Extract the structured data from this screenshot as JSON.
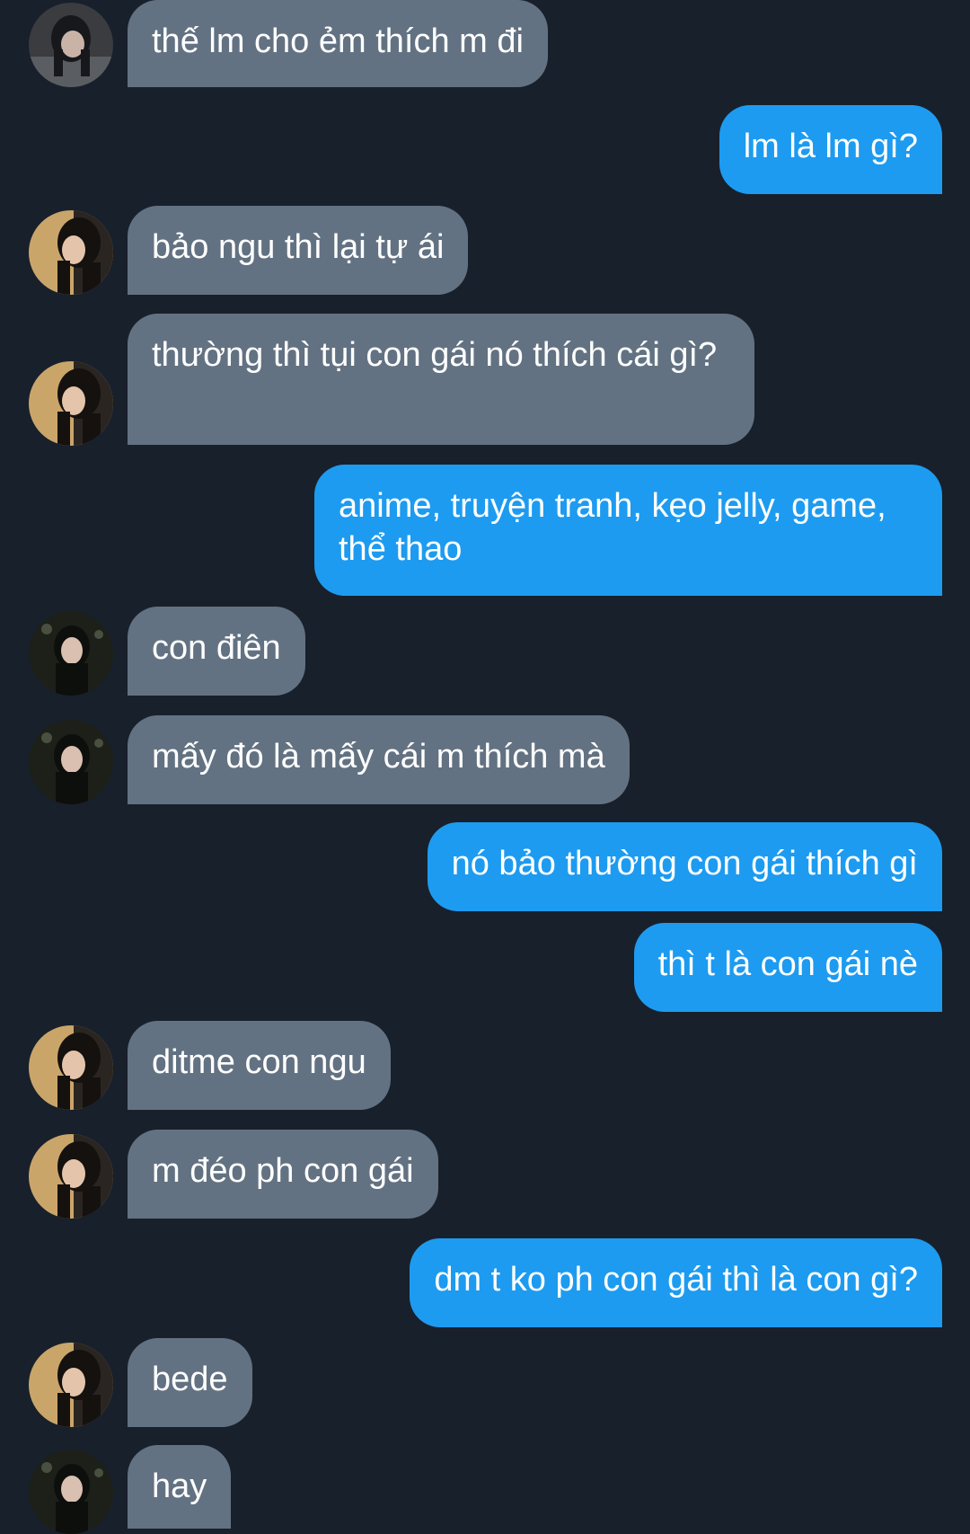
{
  "messages": [
    {
      "side": "in",
      "text": "thế lm cho ẻm thích m đi",
      "avatar": "avatar-photo-1"
    },
    {
      "side": "out",
      "text": "lm là lm gì?"
    },
    {
      "side": "in",
      "text": "bảo ngu thì lại tự ái",
      "avatar": "avatar-photo-2"
    },
    {
      "side": "in",
      "text": "thường thì tụi con gái nó thích cái gì?",
      "avatar": "avatar-photo-2"
    },
    {
      "side": "out",
      "text": "anime, truyện tranh, kẹo jelly, game, thể thao"
    },
    {
      "side": "in",
      "text": "con điên",
      "avatar": "avatar-photo-3"
    },
    {
      "side": "in",
      "text": "mấy đó là mấy cái m thích mà",
      "avatar": "avatar-photo-3"
    },
    {
      "side": "out",
      "text": "nó bảo thường con gái thích gì"
    },
    {
      "side": "out",
      "text": "thì t là con gái nè"
    },
    {
      "side": "in",
      "text": "ditme con ngu",
      "avatar": "avatar-photo-2"
    },
    {
      "side": "in",
      "text": "m đéo ph con gái",
      "avatar": "avatar-photo-2"
    },
    {
      "side": "out",
      "text": "dm t ko ph con gái thì là con gì?"
    },
    {
      "side": "in",
      "text": "bede",
      "avatar": "avatar-photo-2"
    },
    {
      "side": "in",
      "text": "hay",
      "avatar": "avatar-photo-3"
    }
  ],
  "colors": {
    "background": "#18202b",
    "incoming_bubble": "#637282",
    "outgoing_bubble": "#1d9bf0",
    "text": "#ffffff"
  }
}
